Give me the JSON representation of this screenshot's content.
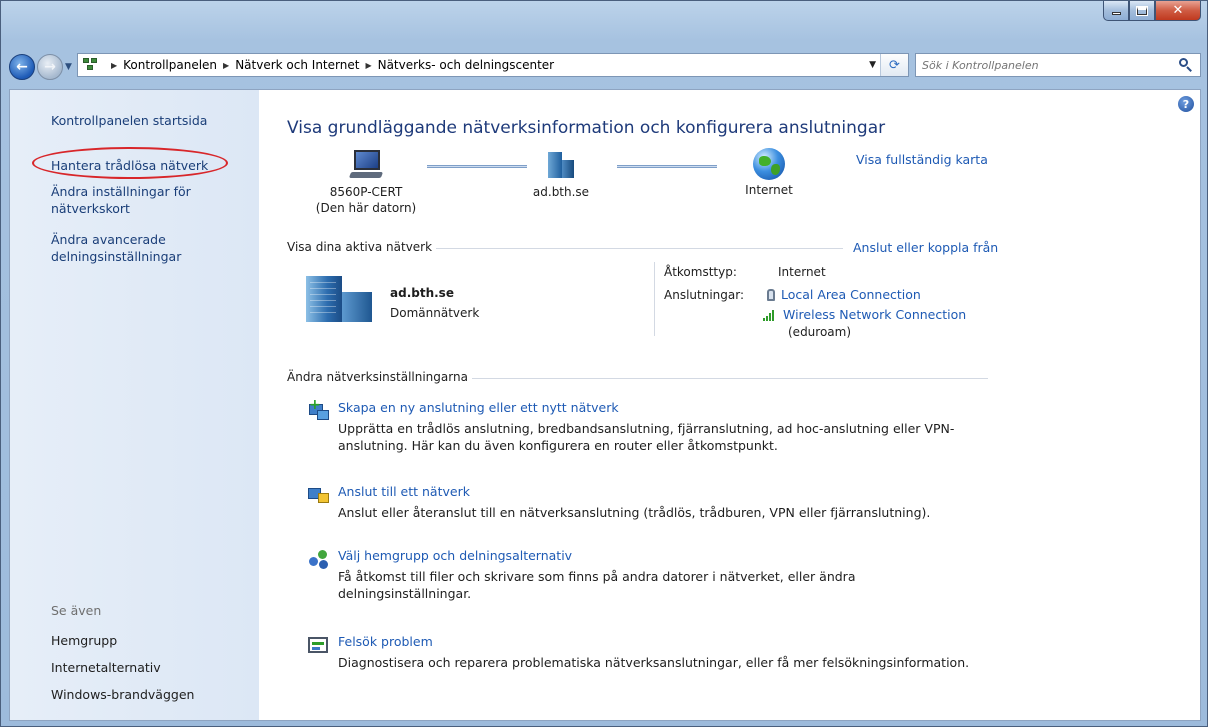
{
  "window": {
    "controls": {
      "minimize": "–",
      "maximize": "□",
      "close": "✕"
    }
  },
  "nav": {
    "breadcrumbs": [
      "Kontrollpanelen",
      "Nätverk och Internet",
      "Nätverks- och delningscenter"
    ],
    "search_placeholder": "Sök i Kontrollpanelen"
  },
  "sidebar": {
    "items": [
      {
        "label": "Kontrollpanelen startsida"
      },
      {
        "label": "Hantera trådlösa nätverk"
      },
      {
        "label": "Ändra inställningar för nätverkskort"
      },
      {
        "label": "Ändra avancerade delningsinställningar"
      }
    ],
    "see_also_label": "Se även",
    "see_also": [
      {
        "label": "Hemgrupp"
      },
      {
        "label": "Internetalternativ"
      },
      {
        "label": "Windows-brandväggen"
      }
    ]
  },
  "main": {
    "title": "Visa grundläggande nätverksinformation och konfigurera anslutningar",
    "full_map_link": "Visa fullständig karta",
    "map": {
      "computer_name": "8560P-CERT",
      "computer_caption": "(Den här datorn)",
      "domain": "ad.bth.se",
      "internet": "Internet"
    },
    "active": {
      "section_label": "Visa dina aktiva nätverk",
      "connect_link": "Anslut eller koppla från",
      "network_name": "ad.bth.se",
      "network_type": "Domännätverk",
      "access_type_label": "Åtkomsttyp:",
      "access_type_value": "Internet",
      "connections_label": "Anslutningar:",
      "connection_1": "Local Area Connection",
      "connection_2_line1": "Wireless Network Connection",
      "connection_2_line2": "(eduroam)"
    },
    "settings": {
      "section_label": "Ändra nätverksinställningarna",
      "tasks": [
        {
          "icon": "new-connection-icon",
          "title": "Skapa en ny anslutning eller ett nytt nätverk",
          "desc": "Upprätta en trådlös anslutning, bredbandsanslutning, fjärranslutning, ad hoc-anslutning eller VPN-anslutning. Här kan du även konfigurera en router eller åtkomstpunkt."
        },
        {
          "icon": "connect-network-icon",
          "title": "Anslut till ett nätverk",
          "desc": "Anslut eller återanslut till en nätverksanslutning (trådlös, trådburen, VPN eller fjärranslutning)."
        },
        {
          "icon": "homegroup-icon",
          "title": "Välj hemgrupp och delningsalternativ",
          "desc": "Få åtkomst till filer och skrivare som finns på andra datorer i nätverket, eller ändra delningsinställningar."
        },
        {
          "icon": "troubleshoot-icon",
          "title": "Felsök problem",
          "desc": "Diagnostisera och reparera problematiska nätverksanslutningar, eller få mer felsökningsinformation."
        }
      ]
    }
  },
  "colors": {
    "link": "#1e5ab4",
    "title": "#1e3a7a",
    "highlight_oval": "#d8262a",
    "sidebar_bg": "#dce7f5"
  }
}
